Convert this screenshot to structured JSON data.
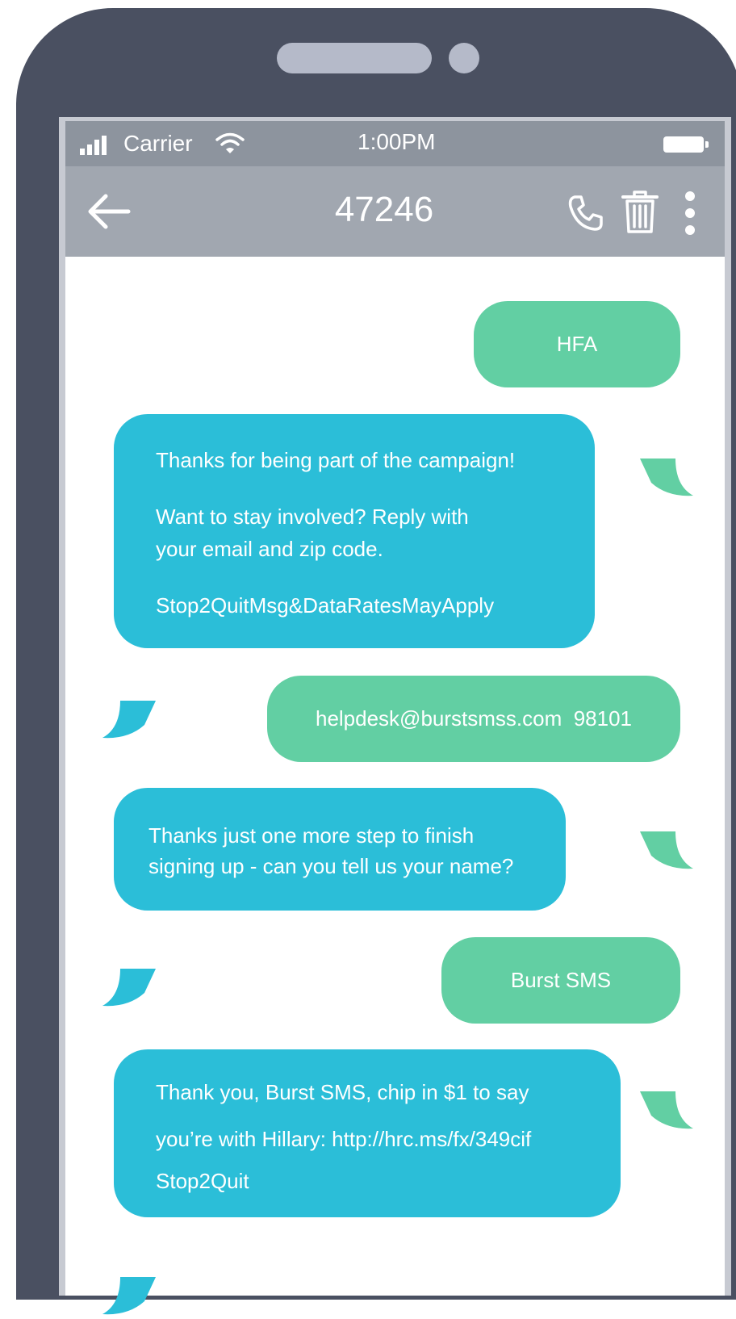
{
  "status_bar": {
    "carrier": "Carrier",
    "time": "1:00PM"
  },
  "conversation": {
    "title": "47246"
  },
  "messages": [
    {
      "direction": "sent",
      "lines": [
        "HFA"
      ]
    },
    {
      "direction": "received",
      "lines": [
        "Thanks for being part of the campaign!",
        "Want to stay involved? Reply with",
        "your email and zip code.",
        "Stop2QuitMsg&DataRatesMayApply"
      ]
    },
    {
      "direction": "sent",
      "lines": [
        "helpdesk@burstsmss.com  98101"
      ]
    },
    {
      "direction": "received",
      "lines": [
        "Thanks just one more step to finish",
        "signing up - can you tell us your name?"
      ]
    },
    {
      "direction": "sent",
      "lines": [
        "Burst SMS"
      ]
    },
    {
      "direction": "received",
      "lines": [
        "Thank you, Burst SMS, chip in $1 to say",
        "you’re with Hillary: http://hrc.ms/fx/349cif",
        "Stop2Quit"
      ]
    }
  ],
  "colors": {
    "sent_bubble": "#62cfa3",
    "received_bubble": "#2bbed8",
    "phone_frame": "#4a5061",
    "status_bar": "#8d949e",
    "nav_bar": "#a1a7b0"
  },
  "icons": {
    "back": "arrow-left-icon",
    "call": "phone-icon",
    "delete": "trash-icon",
    "more": "more-vertical-icon",
    "signal": "signal-icon",
    "wifi": "wifi-icon",
    "battery": "battery-icon"
  }
}
